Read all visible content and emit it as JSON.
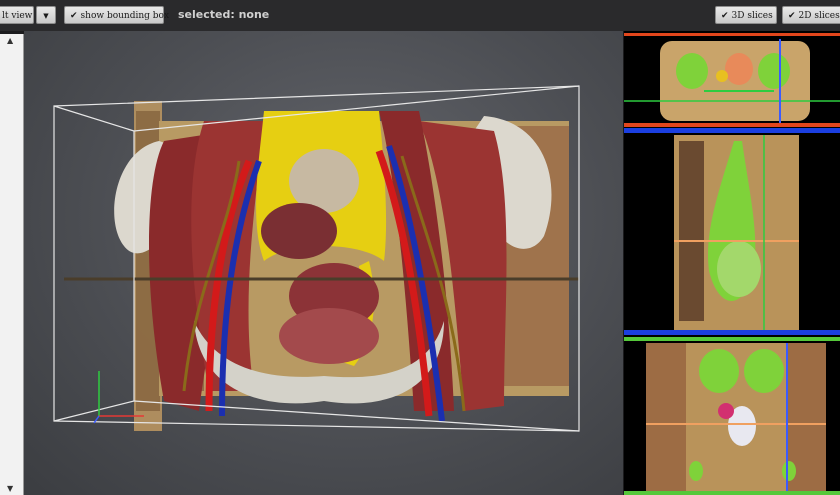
{
  "toolbar": {
    "view_button_label": "lt view",
    "dropdown_glyph": "▼",
    "bounding_box_label": "show bounding box",
    "status_text": "selected: none",
    "slices_3d_label": "3D slices",
    "slices_2d_label": "2D slices",
    "check_glyph": "✔"
  },
  "scrollbar": {
    "up_glyph": "▲",
    "down_glyph": "▼"
  },
  "colors": {
    "viewport_bg": "#55575c",
    "muscle": "#8b2a2b",
    "bone": "#d9d6cc",
    "artery": "#d31a1a",
    "vein": "#1b2fb0",
    "bladder": "#e0c915",
    "slice_axial": "#e2461c",
    "slice_sagittal": "#1b3fe0",
    "slice_coronal": "#55c83a"
  }
}
